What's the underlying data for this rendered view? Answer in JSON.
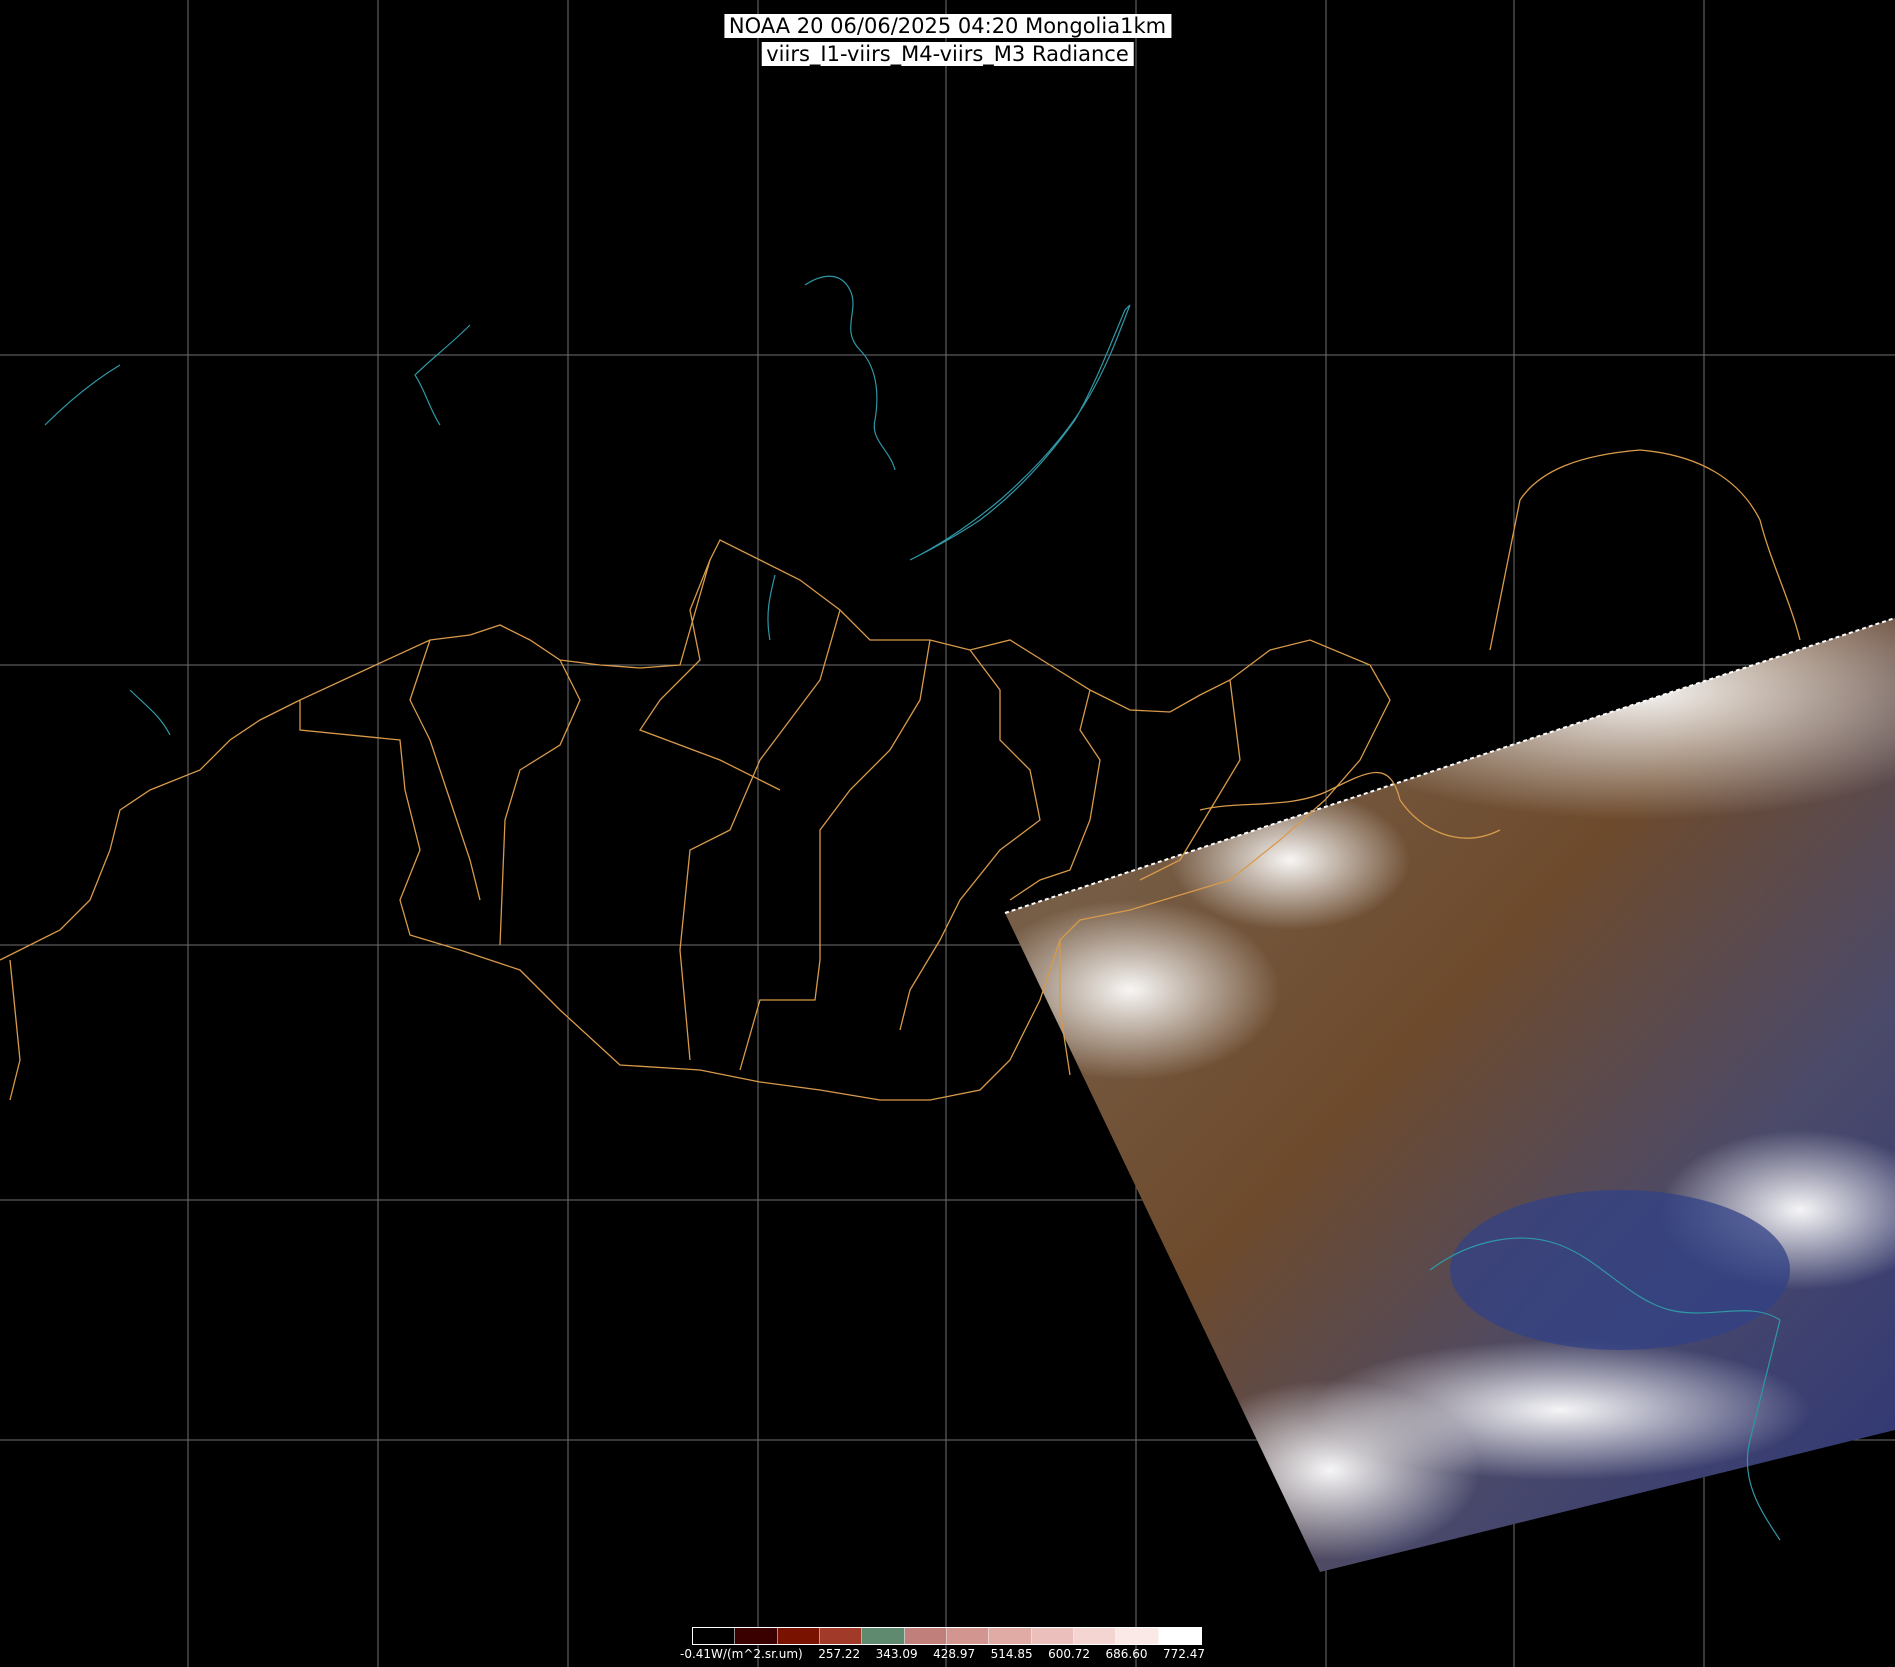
{
  "title": {
    "line1": "NOAA 20 06/06/2025 04:20 Mongolia1km",
    "line2": "viirs_I1-viirs_M4-viirs_M3 Radiance"
  },
  "colors": {
    "background": "#000000",
    "graticule": "#6f6f6f",
    "admin_border": "#d89a4a",
    "water": "#2f97a6",
    "cloud": "#f1f3f6",
    "land": "#8b6b4f",
    "sea": "#3f4f8e"
  },
  "layers": [
    "graticule",
    "coastline-water",
    "admin-borders",
    "satellite-swath"
  ],
  "colorbar": {
    "colors": [
      "#000000",
      "#3a0000",
      "#7a1200",
      "#a23a2a",
      "#5f8a70",
      "#c07f7a",
      "#d39590",
      "#e0aaa5",
      "#ebc0bc",
      "#f4d5d2",
      "#fae9e7",
      "#ffffff"
    ],
    "labels": [
      "-0.41W/(m^2.sr.um)",
      "257.22",
      "343.09",
      "428.97",
      "514.85",
      "600.72",
      "686.60",
      "772.47"
    ]
  }
}
